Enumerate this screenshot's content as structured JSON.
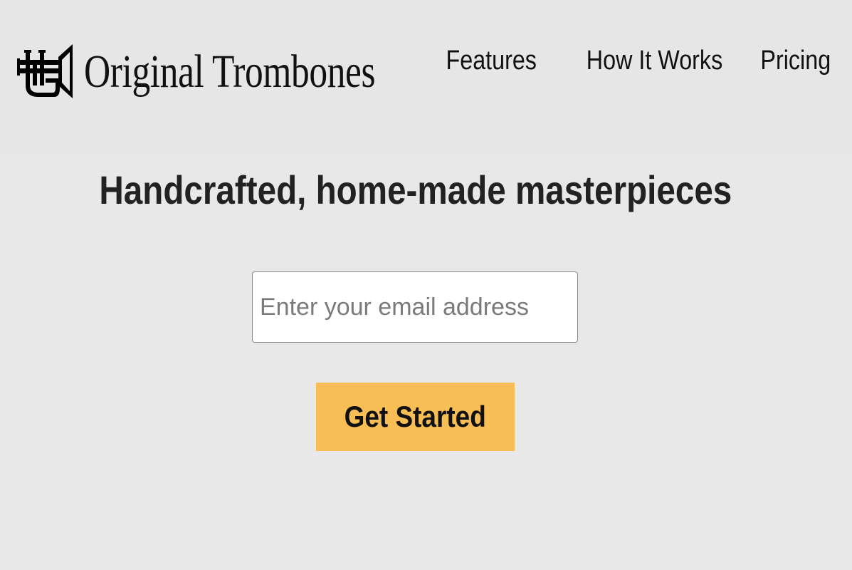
{
  "brand": {
    "name": "Original Trombones",
    "icon": "trumpet-icon",
    "colors": {
      "text": "#111111",
      "background": "#e8e8e8"
    }
  },
  "nav": {
    "items": [
      {
        "label": "Features"
      },
      {
        "label": "How It Works"
      },
      {
        "label": "Pricing"
      }
    ]
  },
  "hero": {
    "headline": "Handcrafted, home-made masterpieces",
    "email_placeholder": "Enter your email address",
    "email_value": "",
    "cta_label": "Get Started",
    "cta_color": "#f6be55"
  }
}
